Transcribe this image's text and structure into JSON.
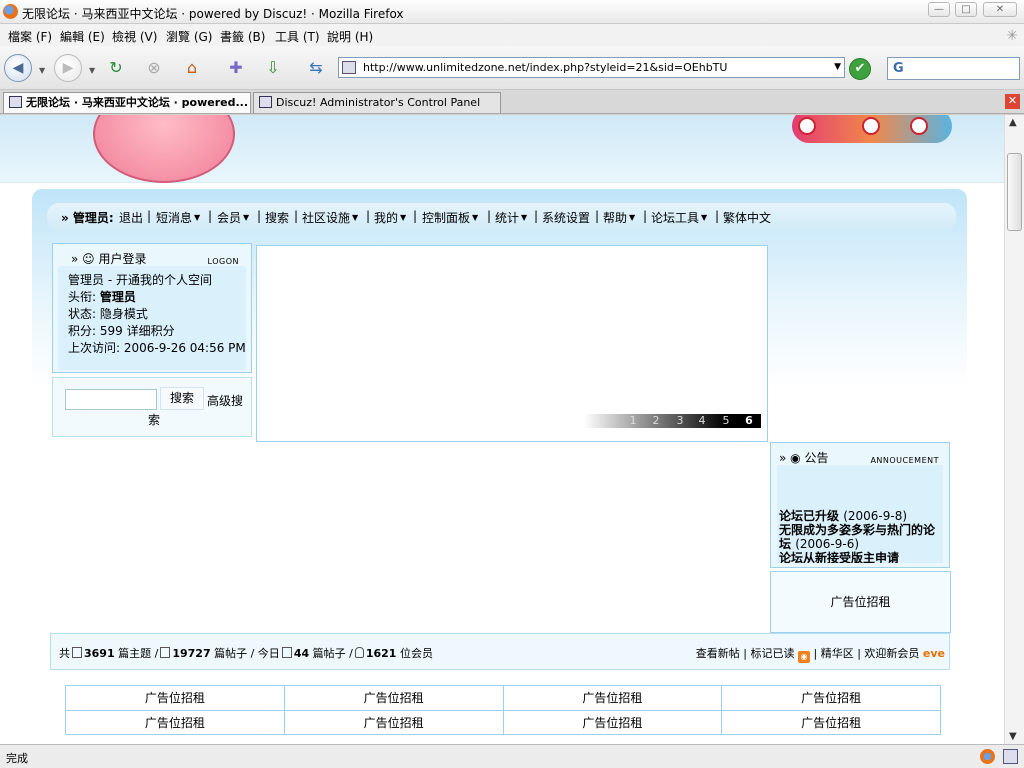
{
  "window": {
    "title": "无限论坛 · 马来西亚中文论坛 · powered by Discuz! · Mozilla Firefox"
  },
  "menu": [
    "檔案 (F)",
    "編輯 (E)",
    "檢視 (V)",
    "瀏覽 (G)",
    "書籤 (B)",
    "工具 (T)",
    "說明 (H)"
  ],
  "toolbar": {
    "url": "http://www.unlimitedzone.net/index.php?styleid=21&sid=OEhbTU",
    "search_engine": "G"
  },
  "tabs": [
    {
      "label": "无限论坛 · 马来西亚中文论坛 · powered...",
      "active": true
    },
    {
      "label": "Discuz! Administrator's Control Panel",
      "active": false
    }
  ],
  "nav": {
    "prefix": "» 管理员:",
    "items": [
      "退出",
      "短消息",
      "会员",
      "搜索",
      "社区设施",
      "我的",
      "控制面板",
      "统计",
      "系统设置",
      "帮助",
      "论坛工具",
      "繁体中文"
    ]
  },
  "login": {
    "title": "用户登录",
    "tag": "LOGON",
    "lines": [
      "管理员  - 开通我的个人空间",
      "头衔: ",
      "状态: 隐身模式",
      "积分: 599 详细积分",
      "上次访问: 2006-9-26 04:56 PM"
    ],
    "title_value": "管理员"
  },
  "search": {
    "button": "搜索",
    "advanced": "高级搜",
    "advanced_wrap": "索"
  },
  "slider": {
    "pages": [
      "1",
      "2",
      "3",
      "4",
      "5",
      "6"
    ],
    "active_page": "6"
  },
  "announcement": {
    "title": "公告",
    "tag": "ANNOUCEMENT",
    "items": [
      {
        "title": "论坛已升级",
        "date": "(2006-9-8)"
      },
      {
        "title": "无限成为多姿多彩与热门的论坛",
        "date": "(2006-9-6)"
      },
      {
        "title": "论坛从新接受版主申请",
        "date": ""
      }
    ]
  },
  "ad_text": "广告位招租",
  "stats": {
    "total_label": "共",
    "threads": "3691",
    "threads_label": "篇主题 /",
    "posts": "19727",
    "posts_label": "篇帖子 / 今日",
    "today": "44",
    "today_label": "篇帖子 /",
    "members": "1621",
    "members_label": "位会员",
    "right_links": "查看新帖 | 标记已读",
    "digest": "| 精华区 | 欢迎新会员",
    "new_member": "eve"
  },
  "ad_table": [
    [
      "广告位招租",
      "广告位招租",
      "广告位招租",
      "广告位招租"
    ],
    [
      "广告位招租",
      "广告位招租",
      "广告位招租",
      "广告位招租"
    ]
  ],
  "status": {
    "text": "完成"
  }
}
